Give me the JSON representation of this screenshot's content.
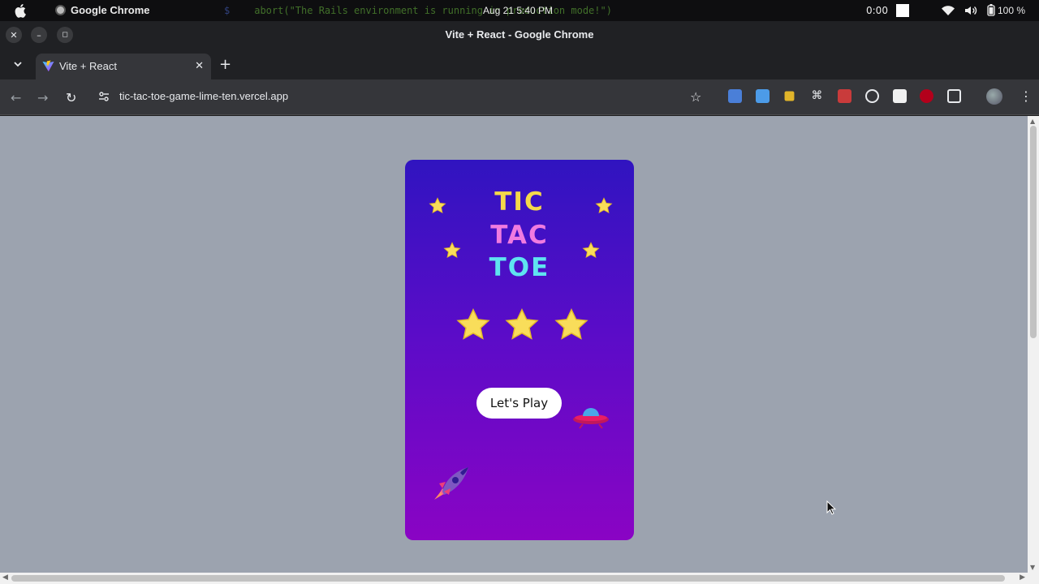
{
  "menubar": {
    "app_name": "Google Chrome",
    "terminal_prompt": "$",
    "terminal_text": "abort(\"The Rails environment is running in production mode!\")",
    "clock": "Aug 21  5:40 PM",
    "recording_timer": "0:00",
    "battery": "100 %"
  },
  "window": {
    "title": "Vite + React - Google Chrome"
  },
  "tab": {
    "label": "Vite + React"
  },
  "omnibox": {
    "url": "tic-tac-toe-game-lime-ten.vercel.app"
  },
  "colors": {
    "card_top": "#3014c0",
    "card_bottom": "#8a04c4",
    "tic": "#f5d94a",
    "tac": "#f07be0",
    "toe": "#5fe3f0",
    "page_bg": "#9ca3af",
    "star": "#f9dd5a"
  },
  "game": {
    "title_line1": "TIC",
    "title_line2": "TAC",
    "title_line3": "TOE",
    "play_button": "Let's Play"
  },
  "icons": {
    "decor": [
      "star-icon",
      "ufo-icon",
      "rocket-icon"
    ]
  }
}
